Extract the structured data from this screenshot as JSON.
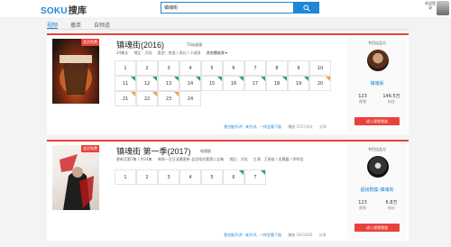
{
  "header": {
    "logo_main": "SOKU",
    "logo_sub": "搜库",
    "search_value": "镇魂街",
    "user_label": "欢迎登录"
  },
  "tabs": [
    "视频",
    "播单",
    "自频道"
  ],
  "cards": [
    {
      "title": "镇魂街(2016)",
      "type_tag": "TV动画版",
      "poster_badge": "会员免费",
      "meta": [
        "24集全",
        "地区：大陆",
        "类型：热血 / 奇幻 / 小说改",
        "其他播放源 ▾"
      ],
      "episodes": [
        "1",
        "2",
        "3",
        "4",
        "5",
        "6",
        "7",
        "8",
        "9",
        "10",
        "11",
        "12",
        "13",
        "14",
        "15",
        "16",
        "17",
        "18",
        "19",
        "20",
        "21",
        "22",
        "23",
        "24"
      ],
      "footer_link": "我也能开讲！来开讲，一样会看下剧",
      "footer_extra": "播放 372万4次",
      "footer_share": "分享",
      "sidebar": {
        "title": "节目出品方",
        "name": "镇魂街",
        "stat1_value": "123",
        "stat1_label": "视频",
        "stat2_value": "146.5万",
        "stat2_label": "粉丝",
        "button": "进入视频频道"
      }
    },
    {
      "title": "镇魂街 第一季(2017)",
      "type_tag": "电视剧",
      "poster_badge": "会员免费",
      "meta": [
        "更新至第7集 / 共24集",
        "每周一至日凌晨更新 会员抢先看第二全集",
        "地区：大陆",
        "主演：王振裕 / 金晨露 / 徐明浩"
      ],
      "episodes": [
        "1",
        "2",
        "3",
        "4",
        "5",
        "6",
        "7"
      ],
      "footer_link": "我也能开讲！来开讲，一样会看下剧",
      "footer_extra": "播放 2415435",
      "footer_share": "分享",
      "sidebar": {
        "title": "节目出品方",
        "name": "超级剧集-镇魂街",
        "stat1_value": "123",
        "stat1_label": "视频",
        "stat2_value": "6.8万",
        "stat2_label": "粉丝",
        "button": "进入视频频道"
      }
    }
  ],
  "colors": {
    "accent": "#1e87d6",
    "brand_red": "#e8433b"
  }
}
